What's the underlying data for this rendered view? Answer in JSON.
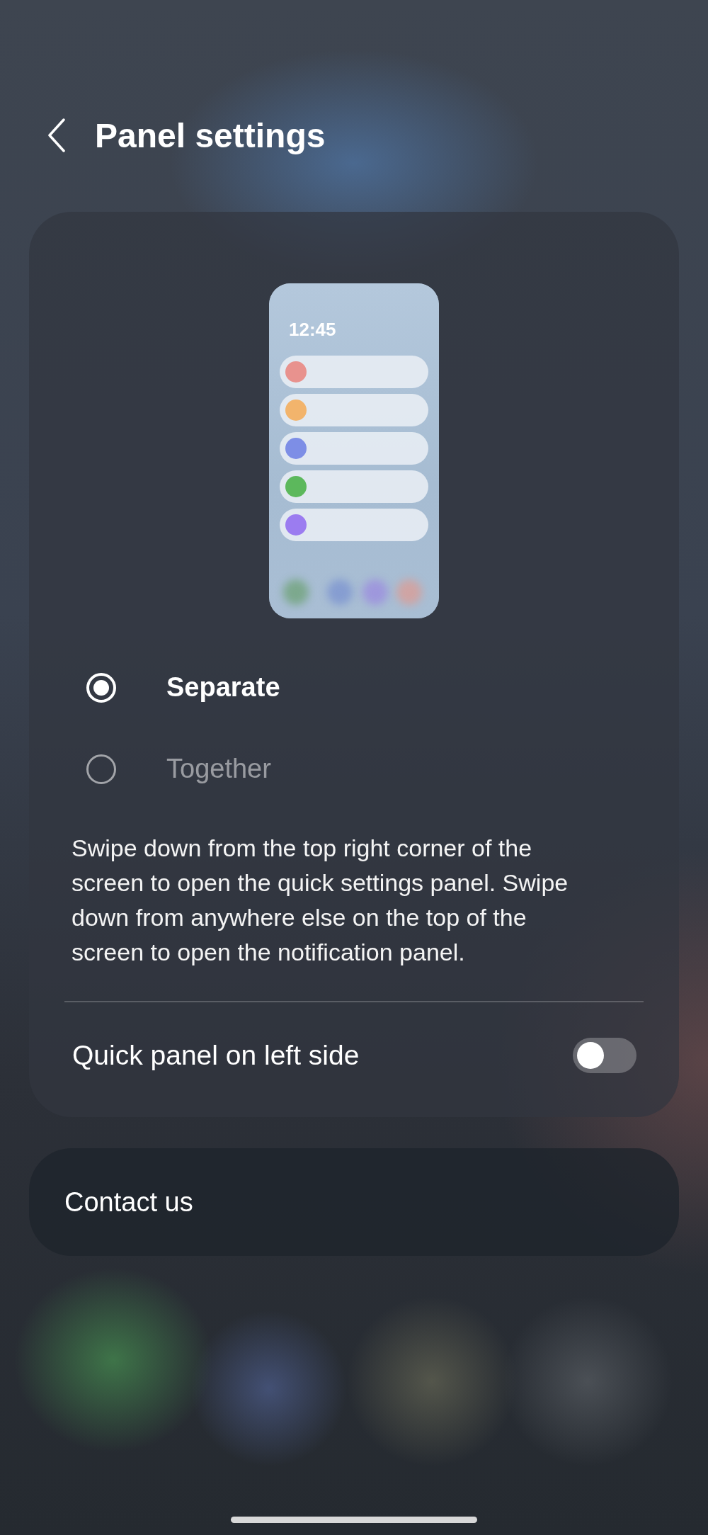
{
  "header": {
    "title": "Panel settings"
  },
  "preview": {
    "time": "12:45",
    "notifications": [
      {
        "color": "#e8928e"
      },
      {
        "color": "#f2b46c"
      },
      {
        "color": "#7d8ee6"
      },
      {
        "color": "#5cb85c"
      },
      {
        "color": "#9b7cf0"
      }
    ]
  },
  "options": [
    {
      "label": "Separate",
      "selected": true
    },
    {
      "label": "Together",
      "selected": false
    }
  ],
  "description": "Swipe down from the top right corner of the screen to open the quick settings panel. Swipe down from anywhere else on the top of the screen to open the notification panel.",
  "toggles": [
    {
      "label": "Quick panel on left side",
      "on": false
    }
  ],
  "links": [
    {
      "label": "Contact us"
    }
  ]
}
